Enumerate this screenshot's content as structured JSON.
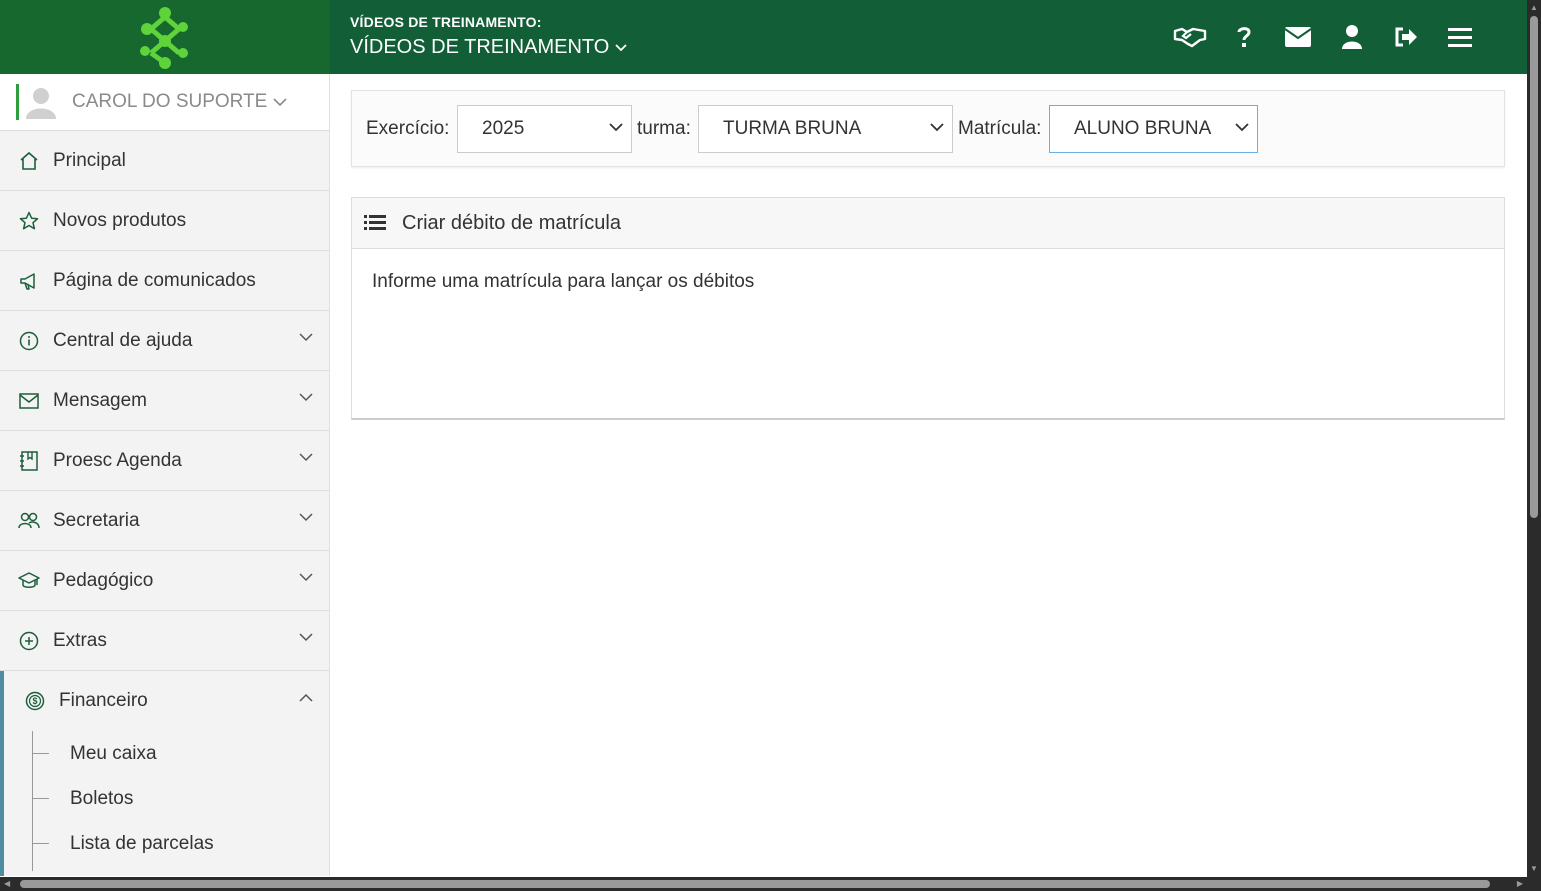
{
  "header": {
    "subtitle": "VÍDEOS DE TREINAMENTO:",
    "title": "VÍDEOS DE TREINAMENTO",
    "icons": [
      "handshake-icon",
      "help-icon",
      "mail-icon",
      "user-icon",
      "logout-icon",
      "menu-icon"
    ]
  },
  "user": {
    "name": "CAROL DO SUPORTE"
  },
  "sidebar": {
    "items": [
      {
        "label": "Principal",
        "icon": "home-icon"
      },
      {
        "label": "Novos produtos",
        "icon": "star-icon"
      },
      {
        "label": "Página de comunicados",
        "icon": "megaphone-icon"
      },
      {
        "label": "Central de ajuda",
        "icon": "info-icon"
      },
      {
        "label": "Mensagem",
        "icon": "envelope-icon"
      },
      {
        "label": "Proesc Agenda",
        "icon": "agenda-icon"
      },
      {
        "label": "Secretaria",
        "icon": "people-icon"
      },
      {
        "label": "Pedagógico",
        "icon": "graduation-cap-icon"
      },
      {
        "label": "Extras",
        "icon": "plus-circle-icon"
      }
    ],
    "financeiro": {
      "label": "Financeiro",
      "icon": "dollar-circle-icon",
      "subitems": [
        "Meu caixa",
        "Boletos",
        "Lista de parcelas"
      ]
    }
  },
  "filters": {
    "exercicio_label": "Exercício:",
    "exercicio_value": "2025",
    "turma_label": "turma:",
    "turma_value": "TURMA BRUNA",
    "matricula_label": "Matrícula:",
    "matricula_value": "ALUNO BRUNA"
  },
  "card": {
    "title": "Criar débito de matrícula",
    "message": "Informe uma matrícula para lançar os débitos"
  },
  "colors": {
    "header_bg": "#115e37",
    "logo_bg": "#16682f",
    "logo_green": "#5fd33a",
    "accent_blue": "#4f8ea0",
    "icon_green": "#1d5e3b"
  }
}
